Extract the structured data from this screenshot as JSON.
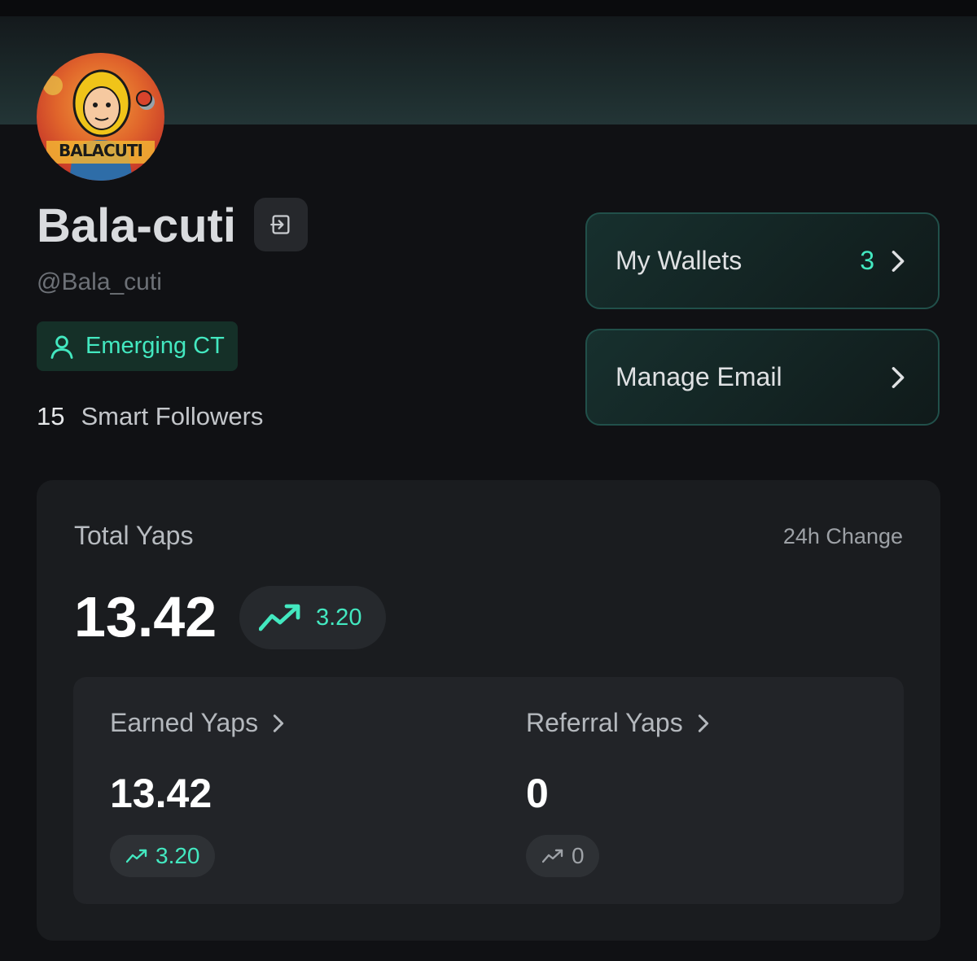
{
  "profile": {
    "avatar_text": "BALACUTI",
    "name": "Bala-cuti",
    "handle": "@Bala_cuti",
    "tier": "Emerging CT",
    "smart_followers_count": "15",
    "smart_followers_label": "Smart Followers"
  },
  "actions": {
    "wallets_label": "My Wallets",
    "wallets_count": "3",
    "email_label": "Manage Email"
  },
  "yaps": {
    "total_label": "Total Yaps",
    "change_label": "24h Change",
    "total_value": "13.42",
    "total_change": "3.20",
    "earned": {
      "label": "Earned Yaps",
      "value": "13.42",
      "change": "3.20"
    },
    "referral": {
      "label": "Referral Yaps",
      "value": "0",
      "change": "0"
    }
  },
  "colors": {
    "accent": "#43e8c0",
    "background": "#101114",
    "card": "#1a1c1f"
  },
  "icons": [
    "logout-icon",
    "user-icon",
    "chevron-right-icon",
    "trending-up-icon"
  ]
}
